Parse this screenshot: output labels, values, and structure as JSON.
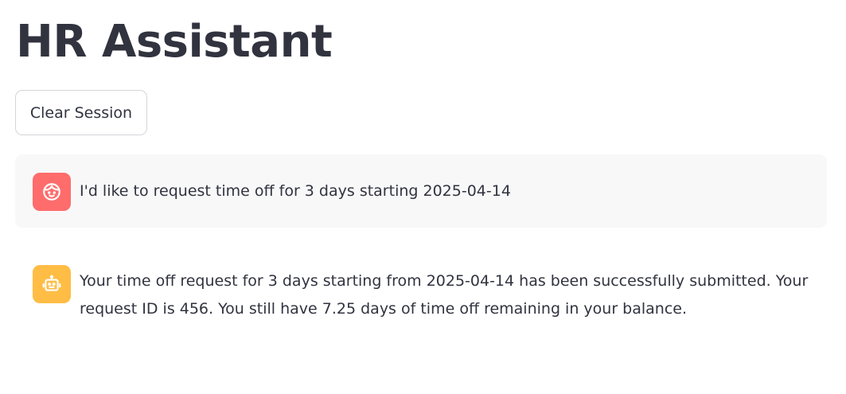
{
  "header": {
    "title": "HR Assistant"
  },
  "toolbar": {
    "clear_session_label": "Clear Session"
  },
  "chat": {
    "messages": [
      {
        "role": "user",
        "avatar_icon": "user-face-icon",
        "avatar_color": "#ff6c6c",
        "text": "I'd like to request time off for 3 days starting 2025-04-14"
      },
      {
        "role": "assistant",
        "avatar_icon": "robot-icon",
        "avatar_color": "#ffbd45",
        "text": "Your time off request for 3 days starting from 2025-04-14 has been successfully submitted. Your request ID is 456. You still have 7.25 days of time off remaining in your balance."
      }
    ]
  }
}
